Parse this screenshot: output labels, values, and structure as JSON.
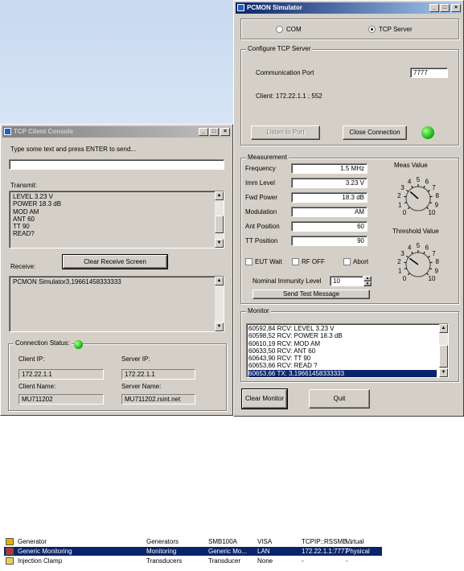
{
  "client": {
    "title": "TCP Client Console",
    "prompt": "Type some text and press ENTER to send...",
    "send_value": "",
    "transmit_label": "Transmit:",
    "transmit_lines": [
      "LEVEL 3.23 V",
      "POWER 18.3 dB",
      "MOD AM",
      "ANT 60",
      "TT 90",
      "READ?"
    ],
    "clear_button": "Clear Receive Screen",
    "receive_label": "Receive:",
    "receive_lines": [
      "PCMON Simulator3,19661458333333"
    ],
    "conn_status_label": "Connection Status:",
    "client_ip_label": "Client IP:",
    "client_ip": "172.22.1.1",
    "server_ip_label": "Server IP:",
    "server_ip": "172.22.1.1",
    "client_name_label": "Client Name:",
    "client_name": "MU711202",
    "server_name_label": "Server Name:",
    "server_name": "MU711202.rsint.net",
    "status_color": "#1fb81f"
  },
  "pcmon": {
    "title": "PCMON Simulator",
    "mode_com": "COM",
    "mode_tcp": "TCP Server",
    "mode_selected": "TCP Server",
    "config_label": "Configure TCP Server",
    "port_label": "Communication Port",
    "port_value": "7777",
    "client_info": "Client: 172.22.1.1 ; 552",
    "listen_button": "Listen to Port",
    "close_button": "Close Connection",
    "status_color": "#1fb81f",
    "measurement_label": "Measurement",
    "fields": [
      {
        "label": "Frequency",
        "value": "1.5 MHz"
      },
      {
        "label": "Imm Level",
        "value": "3.23 V"
      },
      {
        "label": "Fwd Power",
        "value": "18.3 dB"
      },
      {
        "label": "Modulation",
        "value": "AM"
      },
      {
        "label": "Ant Position",
        "value": "60"
      },
      {
        "label": "TT Position",
        "value": "90"
      }
    ],
    "eut_wait": "EUT Wait",
    "rf_off": "RF OFF",
    "abort": "Abort",
    "immunity_label": "Nominal Immunity Level",
    "immunity_value": "10",
    "send_test_button": "Send Test Message",
    "meas_value_label": "Meas Value",
    "threshold_label": "Threshold Value",
    "dial_ticks": [
      "0",
      "1",
      "2",
      "3",
      "4",
      "5",
      "6",
      "7",
      "8",
      "9",
      "10"
    ],
    "meas_dial_value": 3.2,
    "threshold_dial_value": 3.0,
    "monitor_label": "Monitor",
    "monitor_lines": [
      "60592,84 RCV: LEVEL 3.23 V",
      "60598,52 RCV: POWER 18.3 dB",
      "60610,19 RCV: MOD AM",
      "60633,50 RCV: ANT 60",
      "60643,90 RCV: TT 90",
      "60653,66 RCV: READ ?",
      "60653,66 TX:  3,19661458333333"
    ],
    "monitor_selected_index": 6,
    "clear_monitor_button": "Clear Monitor",
    "quit_button": "Quit"
  },
  "devices": [
    {
      "name": "Generator",
      "category": "Generators",
      "model": "SMB100A",
      "interface": "VISA",
      "address": "TCPIP::RSSMB...",
      "type": "Virtual",
      "icon": "generator-icon",
      "selected": false
    },
    {
      "name": "Generic Monitoring",
      "category": "Monitoring",
      "model": "Generic Mo...",
      "interface": "LAN",
      "address": "172.22.1.1:7777",
      "type": "Physical",
      "icon": "monitor-icon",
      "selected": true
    },
    {
      "name": "Injection Clamp",
      "category": "Transducers",
      "model": "Transducer",
      "interface": "None",
      "address": "-",
      "type": "-",
      "icon": "clamp-icon",
      "selected": false
    }
  ]
}
